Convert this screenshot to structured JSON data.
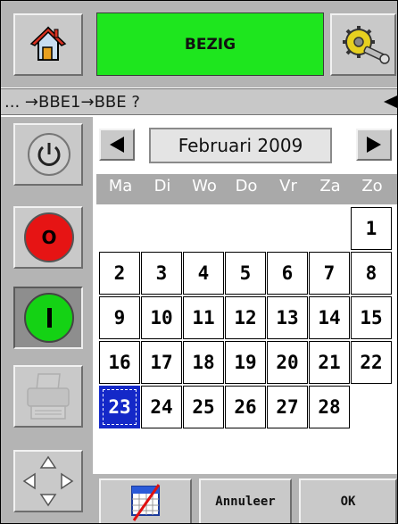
{
  "header": {
    "status": "BEZIG"
  },
  "path": {
    "text": "... →BBE1→BBE ?"
  },
  "calendar": {
    "month_label": "Februari 2009",
    "day_names": [
      "Ma",
      "Di",
      "Wo",
      "Do",
      "Vr",
      "Za",
      "Zo"
    ],
    "weeks": [
      [
        "",
        "",
        "",
        "",
        "",
        "",
        "1"
      ],
      [
        "2",
        "3",
        "4",
        "5",
        "6",
        "7",
        "8"
      ],
      [
        "9",
        "10",
        "11",
        "12",
        "13",
        "14",
        "15"
      ],
      [
        "16",
        "17",
        "18",
        "19",
        "20",
        "21",
        "22"
      ],
      [
        "23",
        "24",
        "25",
        "26",
        "27",
        "28",
        ""
      ]
    ],
    "selected_day": "23"
  },
  "buttons": {
    "cancel": "Annuleer",
    "ok": "OK"
  },
  "icons": {
    "home": "home-icon",
    "settings": "gear-wrench-icon",
    "power": "power-icon",
    "stop": "stop-icon",
    "start": "start-icon",
    "printer": "printer-icon",
    "navigation": "dpad-arrows-icon",
    "clear_date": "calendar-clear-icon",
    "back": "back-arrow-icon"
  },
  "colors": {
    "status_green": "#1ee61e",
    "stop_red": "#e61414",
    "start_green": "#14d214",
    "selected_blue": "#1428c8"
  }
}
